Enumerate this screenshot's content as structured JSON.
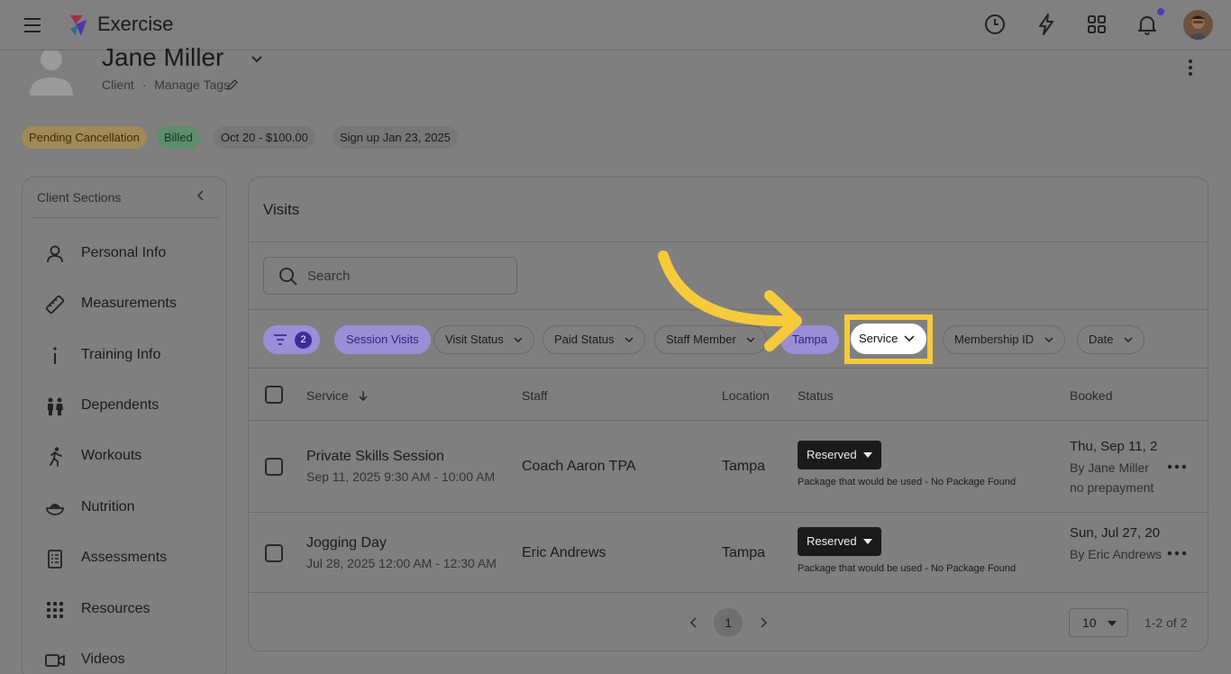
{
  "app": {
    "title": "Exercise"
  },
  "topbar": {
    "icons": [
      "menu-icon",
      "history-icon",
      "lightning-icon",
      "apps-grid-icon",
      "bell-icon"
    ]
  },
  "client": {
    "name": "Jane Miller",
    "role": "Client",
    "separator": "·",
    "manage_tags": "Manage Tags",
    "chips": [
      {
        "label": "Pending Cancellation",
        "color": "#b89a4f"
      },
      {
        "label": "Billed",
        "color": "#5f9a74"
      },
      {
        "label": "Oct 20 - $100.00",
        "color": "#777777"
      },
      {
        "label": "Sign up Jan 23, 2025",
        "color": "#777777"
      }
    ]
  },
  "sidebar": {
    "title": "Client Sections",
    "items": [
      {
        "label": "Personal Info",
        "icon": "person-icon"
      },
      {
        "label": "Measurements",
        "icon": "ruler-icon"
      },
      {
        "label": "Training Info",
        "icon": "info-icon"
      },
      {
        "label": "Dependents",
        "icon": "family-icon"
      },
      {
        "label": "Workouts",
        "icon": "runner-icon"
      },
      {
        "label": "Nutrition",
        "icon": "bowl-icon"
      },
      {
        "label": "Assessments",
        "icon": "clipboard-icon"
      },
      {
        "label": "Resources",
        "icon": "grid-dots-icon"
      },
      {
        "label": "Videos",
        "icon": "video-icon"
      }
    ]
  },
  "visits": {
    "title": "Visits",
    "search_placeholder": "Search",
    "filter_count": "2",
    "filters": {
      "session_visits": "Session Visits",
      "visit_status": "Visit Status",
      "paid_status": "Paid Status",
      "staff_member": "Staff Member",
      "tampa": "Tampa",
      "service": "Service",
      "membership_id": "Membership ID",
      "date": "Date"
    },
    "columns": {
      "service": "Service",
      "staff": "Staff",
      "location": "Location",
      "status": "Status",
      "booked": "Booked"
    },
    "rows": [
      {
        "service": "Private Skills Session",
        "time": "Sep 11, 2025 9:30 AM - 10:00 AM",
        "staff": "Coach Aaron TPA",
        "location": "Tampa",
        "status": "Reserved",
        "package_note": "Package that would be used - No Package Found",
        "booked_date": "Thu, Sep 11, 2",
        "booked_by": "By Jane Miller",
        "booked_extra": "no prepayment"
      },
      {
        "service": "Jogging Day",
        "time": "Jul 28, 2025 12:00 AM - 12:30 AM",
        "staff": "Eric Andrews",
        "location": "Tampa",
        "status": "Reserved",
        "package_note": "Package that would be used - No Package Found",
        "booked_date": "Sun, Jul 27, 20",
        "booked_by": "By Eric Andrews",
        "booked_extra": ""
      }
    ],
    "pagination": {
      "current_page": "1",
      "per_page": "10",
      "range": "1-2 of 2"
    }
  },
  "colors": {
    "highlight": "#f6cb3b",
    "accent_purple": "#4b3bbd",
    "chip_purple": "#9a8fd6"
  }
}
